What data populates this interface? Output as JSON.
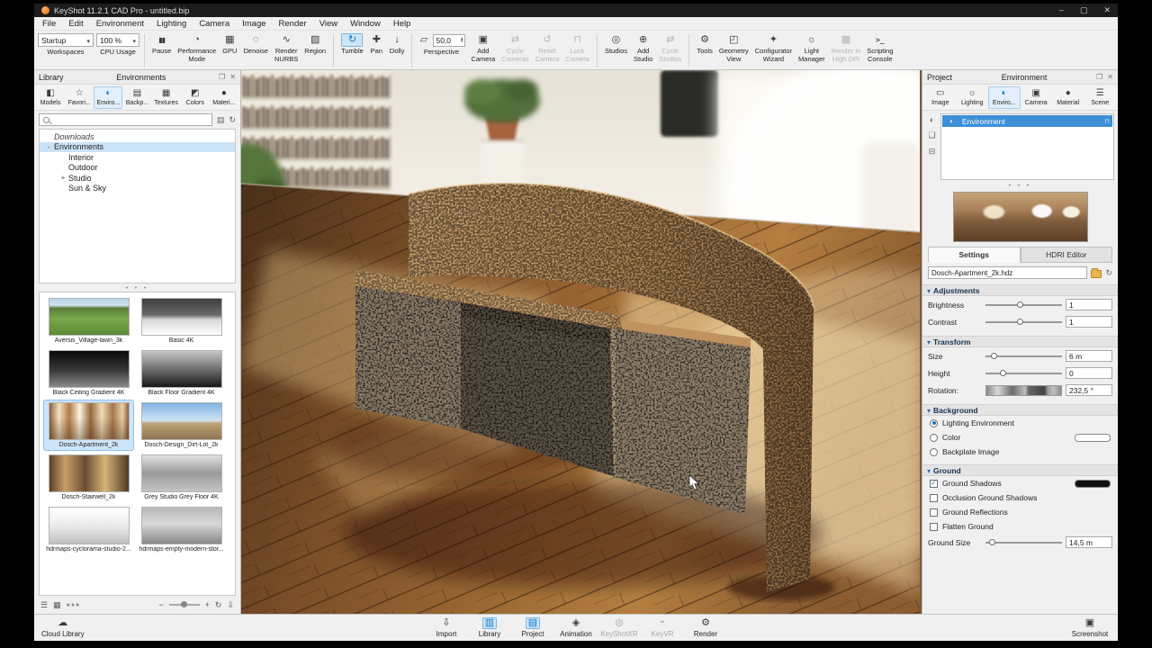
{
  "colors": {
    "accent": "#1277c8",
    "selection": "#cde5f8",
    "selection_border": "#7cb3e2",
    "env_row": "#3d8fd6",
    "title_bar": "#1c1c1c"
  },
  "window": {
    "title": "KeyShot 11.2.1 CAD Pro - untitled.bip"
  },
  "menu": {
    "items": [
      "File",
      "Edit",
      "Environment",
      "Lighting",
      "Camera",
      "Image",
      "Render",
      "View",
      "Window",
      "Help"
    ]
  },
  "toolbar": {
    "workspaces": {
      "value": "Startup",
      "label": "Workspaces"
    },
    "cpu": {
      "value": "100 %",
      "label": "CPU Usage"
    },
    "render_group": [
      {
        "label": "Pause",
        "icon": "pause",
        "icon_name": "pause-icon"
      },
      {
        "label": "Performance\nMode",
        "icon": "performance",
        "icon_name": "performance-mode-icon"
      },
      {
        "label": "GPU",
        "icon": "gpu",
        "icon_name": "gpu-icon"
      },
      {
        "label": "Denoise",
        "icon": "denoise",
        "icon_name": "denoise-icon"
      },
      {
        "label": "Render\nNURBS",
        "icon": "nurbs",
        "icon_name": "render-nurbs-icon"
      },
      {
        "label": "Region",
        "icon": "region",
        "icon_name": "region-icon"
      }
    ],
    "nav_group": [
      {
        "label": "Tumble",
        "icon": "tumble",
        "icon_name": "tumble-icon",
        "active": true
      },
      {
        "label": "Pan",
        "icon": "pan",
        "icon_name": "pan-icon"
      },
      {
        "label": "Dolly",
        "icon": "dolly",
        "icon_name": "dolly-icon"
      }
    ],
    "perspective": {
      "label": "Perspective",
      "value": "50,0"
    },
    "camera_group": [
      {
        "label": "Add\nCamera",
        "icon": "add-camera",
        "icon_name": "add-camera-icon"
      },
      {
        "label": "Cycle\nCameras",
        "icon": "cycle",
        "icon_name": "cycle-cameras-icon",
        "disabled": true
      },
      {
        "label": "Reset\nCamera",
        "icon": "reset",
        "icon_name": "reset-camera-icon",
        "disabled": true
      },
      {
        "label": "Lock\nCamera",
        "icon": "lock",
        "icon_name": "lock-camera-icon",
        "disabled": true
      }
    ],
    "studio_group": [
      {
        "label": "Studios",
        "icon": "studios",
        "icon_name": "studios-icon"
      },
      {
        "label": "Add\nStudio",
        "icon": "add-studio",
        "icon_name": "add-studio-icon"
      },
      {
        "label": "Cycle\nStudios",
        "icon": "cycle",
        "icon_name": "cycle-studios-icon",
        "disabled": true
      }
    ],
    "tool_group": [
      {
        "label": "Tools",
        "icon": "tools",
        "icon_name": "tools-icon"
      },
      {
        "label": "Geometry\nView",
        "icon": "geometry",
        "icon_name": "geometry-view-icon"
      },
      {
        "label": "Configurator\nWizard",
        "icon": "wizard",
        "icon_name": "configurator-wizard-icon"
      },
      {
        "label": "Light\nManager",
        "icon": "light",
        "icon_name": "light-manager-icon"
      },
      {
        "label": "Render in\nHigh DPI",
        "icon": "hidpi",
        "icon_name": "render-high-dpi-icon",
        "disabled": true
      },
      {
        "label": "Scripting\nConsole",
        "icon": "console",
        "icon_name": "scripting-console-icon"
      }
    ]
  },
  "library": {
    "title": "Library",
    "header_title": "Environments",
    "tabs": [
      {
        "label": "Models",
        "icon": "models",
        "icon_name": "models-tab-icon"
      },
      {
        "label": "Favori...",
        "icon": "star",
        "icon_name": "favorites-tab-icon"
      },
      {
        "label": "Enviro...",
        "icon": "globe",
        "icon_name": "environments-tab-icon",
        "active": true
      },
      {
        "label": "Backp...",
        "icon": "backplate",
        "icon_name": "backplates-tab-icon"
      },
      {
        "label": "Textures",
        "icon": "texture",
        "icon_name": "textures-tab-icon"
      },
      {
        "label": "Colors",
        "icon": "colors",
        "icon_name": "colors-tab-icon"
      },
      {
        "label": "Materi...",
        "icon": "material",
        "icon_name": "materials-tab-icon"
      }
    ],
    "tree": [
      {
        "label": "Downloads",
        "italic": true
      },
      {
        "label": "Environments",
        "selected": true,
        "expander": "-"
      },
      {
        "label": "Interior",
        "depth": 1
      },
      {
        "label": "Outdoor",
        "depth": 1
      },
      {
        "label": "Studio",
        "depth": 1,
        "expander": "+"
      },
      {
        "label": "Sun & Sky",
        "depth": 1
      }
    ],
    "thumbnails": [
      {
        "label": "Aversis_Village-lawn_3k",
        "style": "aversis"
      },
      {
        "label": "Basic 4K",
        "style": "basic"
      },
      {
        "label": "Black Ceiling Gradient 4K",
        "style": "black-ceiling"
      },
      {
        "label": "Black Floor Gradient 4K",
        "style": "black-floor"
      },
      {
        "label": "Dosch-Apartment_2k",
        "style": "apartment",
        "selected": true
      },
      {
        "label": "Dosch-Design_Dirt-Lot_2k",
        "style": "dirt-lot"
      },
      {
        "label": "Dosch-Stairwell_2k",
        "style": "stairwell"
      },
      {
        "label": "Grey Studio Grey Floor 4K",
        "style": "grey-studio"
      },
      {
        "label": "hdrmaps-cyclorama-studio-2...",
        "style": "cyclorama"
      },
      {
        "label": "hdrmaps-empty-modern-stor...",
        "style": "modern-store"
      }
    ]
  },
  "project": {
    "title": "Project",
    "header_title": "Environment",
    "tabs": [
      {
        "label": "Image",
        "icon": "image",
        "icon_name": "image-tab-icon"
      },
      {
        "label": "Lighting",
        "icon": "lighting",
        "icon_name": "lighting-tab-icon"
      },
      {
        "label": "Enviro...",
        "icon": "globe",
        "icon_name": "environment-tab-icon",
        "active": true
      },
      {
        "label": "Camera",
        "icon": "camera",
        "icon_name": "camera-tab-icon"
      },
      {
        "label": "Material",
        "icon": "material",
        "icon_name": "material-tab-icon"
      },
      {
        "label": "Scene",
        "icon": "scene",
        "icon_name": "scene-tab-icon"
      }
    ],
    "environment_item": {
      "label": "Environment"
    },
    "settings_tabs": [
      {
        "label": "Settings",
        "active": true
      },
      {
        "label": "HDRI Editor"
      }
    ],
    "hdri_file": "Dosch-Apartment_2k.hdz",
    "adjustments": {
      "title": "Adjustments",
      "rows": [
        {
          "label": "Brightness",
          "value": "1",
          "pct": 45
        },
        {
          "label": "Contrast",
          "value": "1",
          "pct": 45
        }
      ]
    },
    "transform": {
      "title": "Transform",
      "rows": [
        {
          "label": "Size",
          "value": "6 m",
          "pct": 10
        },
        {
          "label": "Height",
          "value": "0",
          "pct": 22
        }
      ],
      "rotation": {
        "label": "Rotation:",
        "value": "232,5 °"
      }
    },
    "background": {
      "title": "Background",
      "options": [
        {
          "label": "Lighting Environment",
          "selected": true
        },
        {
          "label": "Color",
          "swatch": "#ffffff"
        },
        {
          "label": "Backplate Image"
        }
      ]
    },
    "ground": {
      "title": "Ground",
      "options": [
        {
          "label": "Ground Shadows",
          "checked": true,
          "swatch": "#101010"
        },
        {
          "label": "Occlusion Ground Shadows"
        },
        {
          "label": "Ground Reflections"
        },
        {
          "label": "Flatten Ground"
        }
      ],
      "size_row": {
        "label": "Ground Size",
        "value": "14,5 m",
        "pct": 8
      }
    }
  },
  "taskbar": {
    "left": [
      {
        "label": "Cloud Library",
        "icon": "cloud",
        "icon_name": "cloud-library-icon"
      }
    ],
    "center": [
      {
        "label": "Import",
        "icon": "import",
        "icon_name": "import-icon"
      },
      {
        "label": "Library",
        "icon": "library",
        "icon_name": "library-icon",
        "active": true
      },
      {
        "label": "Project",
        "icon": "project",
        "icon_name": "project-icon",
        "active": true
      },
      {
        "label": "Animation",
        "icon": "animation",
        "icon_name": "animation-icon"
      },
      {
        "label": "KeyShotXR",
        "icon": "xr",
        "icon_name": "keyshotxr-icon",
        "disabled": true
      },
      {
        "label": "KeyVR",
        "icon": "vr",
        "icon_name": "keyvr-icon",
        "disabled": true
      },
      {
        "label": "Render",
        "icon": "render",
        "icon_name": "render-icon"
      }
    ],
    "right": [
      {
        "label": "Screenshot",
        "icon": "screenshot",
        "icon_name": "screenshot-icon"
      }
    ]
  }
}
